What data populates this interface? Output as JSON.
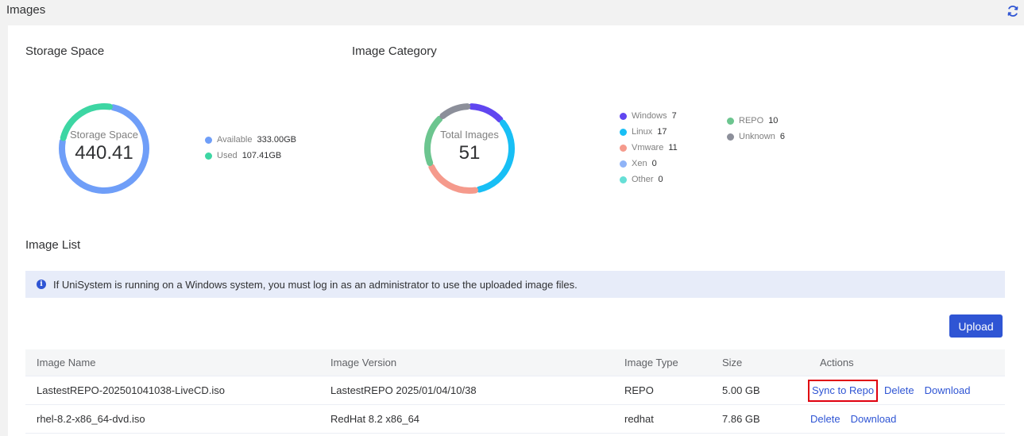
{
  "header": {
    "title": "Images"
  },
  "storage": {
    "section_title": "Storage Space",
    "center_label": "Storage Space",
    "center_value": "440.41",
    "legend": [
      {
        "label": "Available",
        "value": "333.00GB",
        "color": "#6f9ef8"
      },
      {
        "label": "Used",
        "value": "107.41GB",
        "color": "#3dd6a3"
      }
    ]
  },
  "category": {
    "section_title": "Image Category",
    "center_label": "Total Images",
    "center_value": "51",
    "legend_left": [
      {
        "label": "Windows",
        "value": "7",
        "color": "#6046f0"
      },
      {
        "label": "Linux",
        "value": "17",
        "color": "#18bff5"
      },
      {
        "label": "Vmware",
        "value": "11",
        "color": "#f59a8c"
      },
      {
        "label": "Xen",
        "value": "0",
        "color": "#8fb3f7"
      },
      {
        "label": "Other",
        "value": "0",
        "color": "#66dfd6"
      }
    ],
    "legend_right": [
      {
        "label": "REPO",
        "value": "10",
        "color": "#6cc58f"
      },
      {
        "label": "Unknown",
        "value": "6",
        "color": "#8c8f9a"
      }
    ]
  },
  "image_list": {
    "section_title": "Image List",
    "notice": "If UniSystem is running on a Windows system, you must log in as an administrator to use the uploaded image files.",
    "upload_label": "Upload",
    "columns": [
      "Image Name",
      "Image Version",
      "Image Type",
      "Size",
      "Actions"
    ],
    "rows": [
      {
        "name": "LastestREPO-202501041038-LiveCD.iso",
        "version": "LastestREPO 2025/01/04/10/38",
        "type": "REPO",
        "size": "5.00 GB",
        "actions": [
          "Sync to Repo",
          "Delete",
          "Download"
        ]
      },
      {
        "name": "rhel-8.2-x86_64-dvd.iso",
        "version": "RedHat 8.2 x86_64",
        "type": "redhat",
        "size": "7.86 GB",
        "actions": [
          "Delete",
          "Download"
        ]
      }
    ]
  }
}
